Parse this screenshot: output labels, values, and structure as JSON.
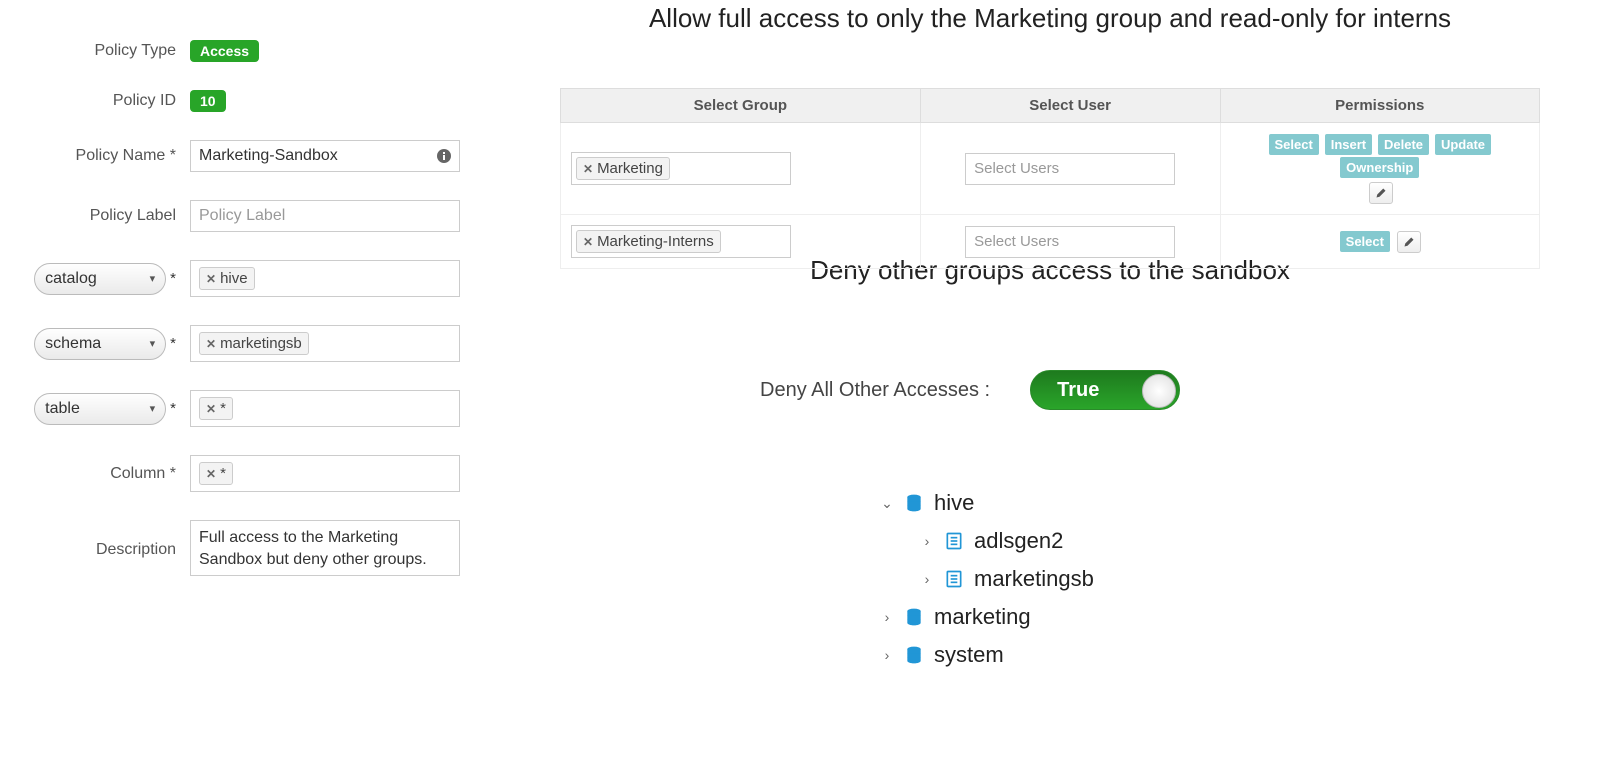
{
  "form": {
    "policy_type_label": "Policy Type",
    "policy_type_badge": "Access",
    "policy_id_label": "Policy ID",
    "policy_id_badge": "10",
    "policy_name_label": "Policy Name *",
    "policy_name_value": "Marketing-Sandbox",
    "policy_label_label": "Policy Label",
    "policy_label_placeholder": "Policy Label",
    "catalog_dd": "catalog",
    "catalog_tag": "hive",
    "schema_dd": "schema",
    "schema_tag": "marketingsb",
    "table_dd": "table",
    "table_tag": "*",
    "column_label": "Column *",
    "column_tag": "*",
    "description_label": "Description",
    "description_value": "Full access to the Marketing Sandbox but deny other groups.",
    "asterisk": "*"
  },
  "annotations": {
    "top": "Allow full access to only the Marketing group and read-only for interns",
    "mid": "Deny other groups access to the sandbox"
  },
  "table": {
    "h1": "Select Group",
    "h2": "Select User",
    "h3": "Permissions",
    "rows": [
      {
        "group_tag": "Marketing",
        "user_placeholder": "Select Users",
        "permissions": [
          "Select",
          "Insert",
          "Delete",
          "Update",
          "Ownership"
        ]
      },
      {
        "group_tag": "Marketing-Interns",
        "user_placeholder": "Select Users",
        "permissions": [
          "Select"
        ]
      }
    ]
  },
  "deny": {
    "label": "Deny All Other Accesses :",
    "value": "True"
  },
  "tree": {
    "root": "hive",
    "children1": [
      "adlsgen2",
      "marketingsb"
    ],
    "siblings": [
      "marketing",
      "system"
    ]
  }
}
